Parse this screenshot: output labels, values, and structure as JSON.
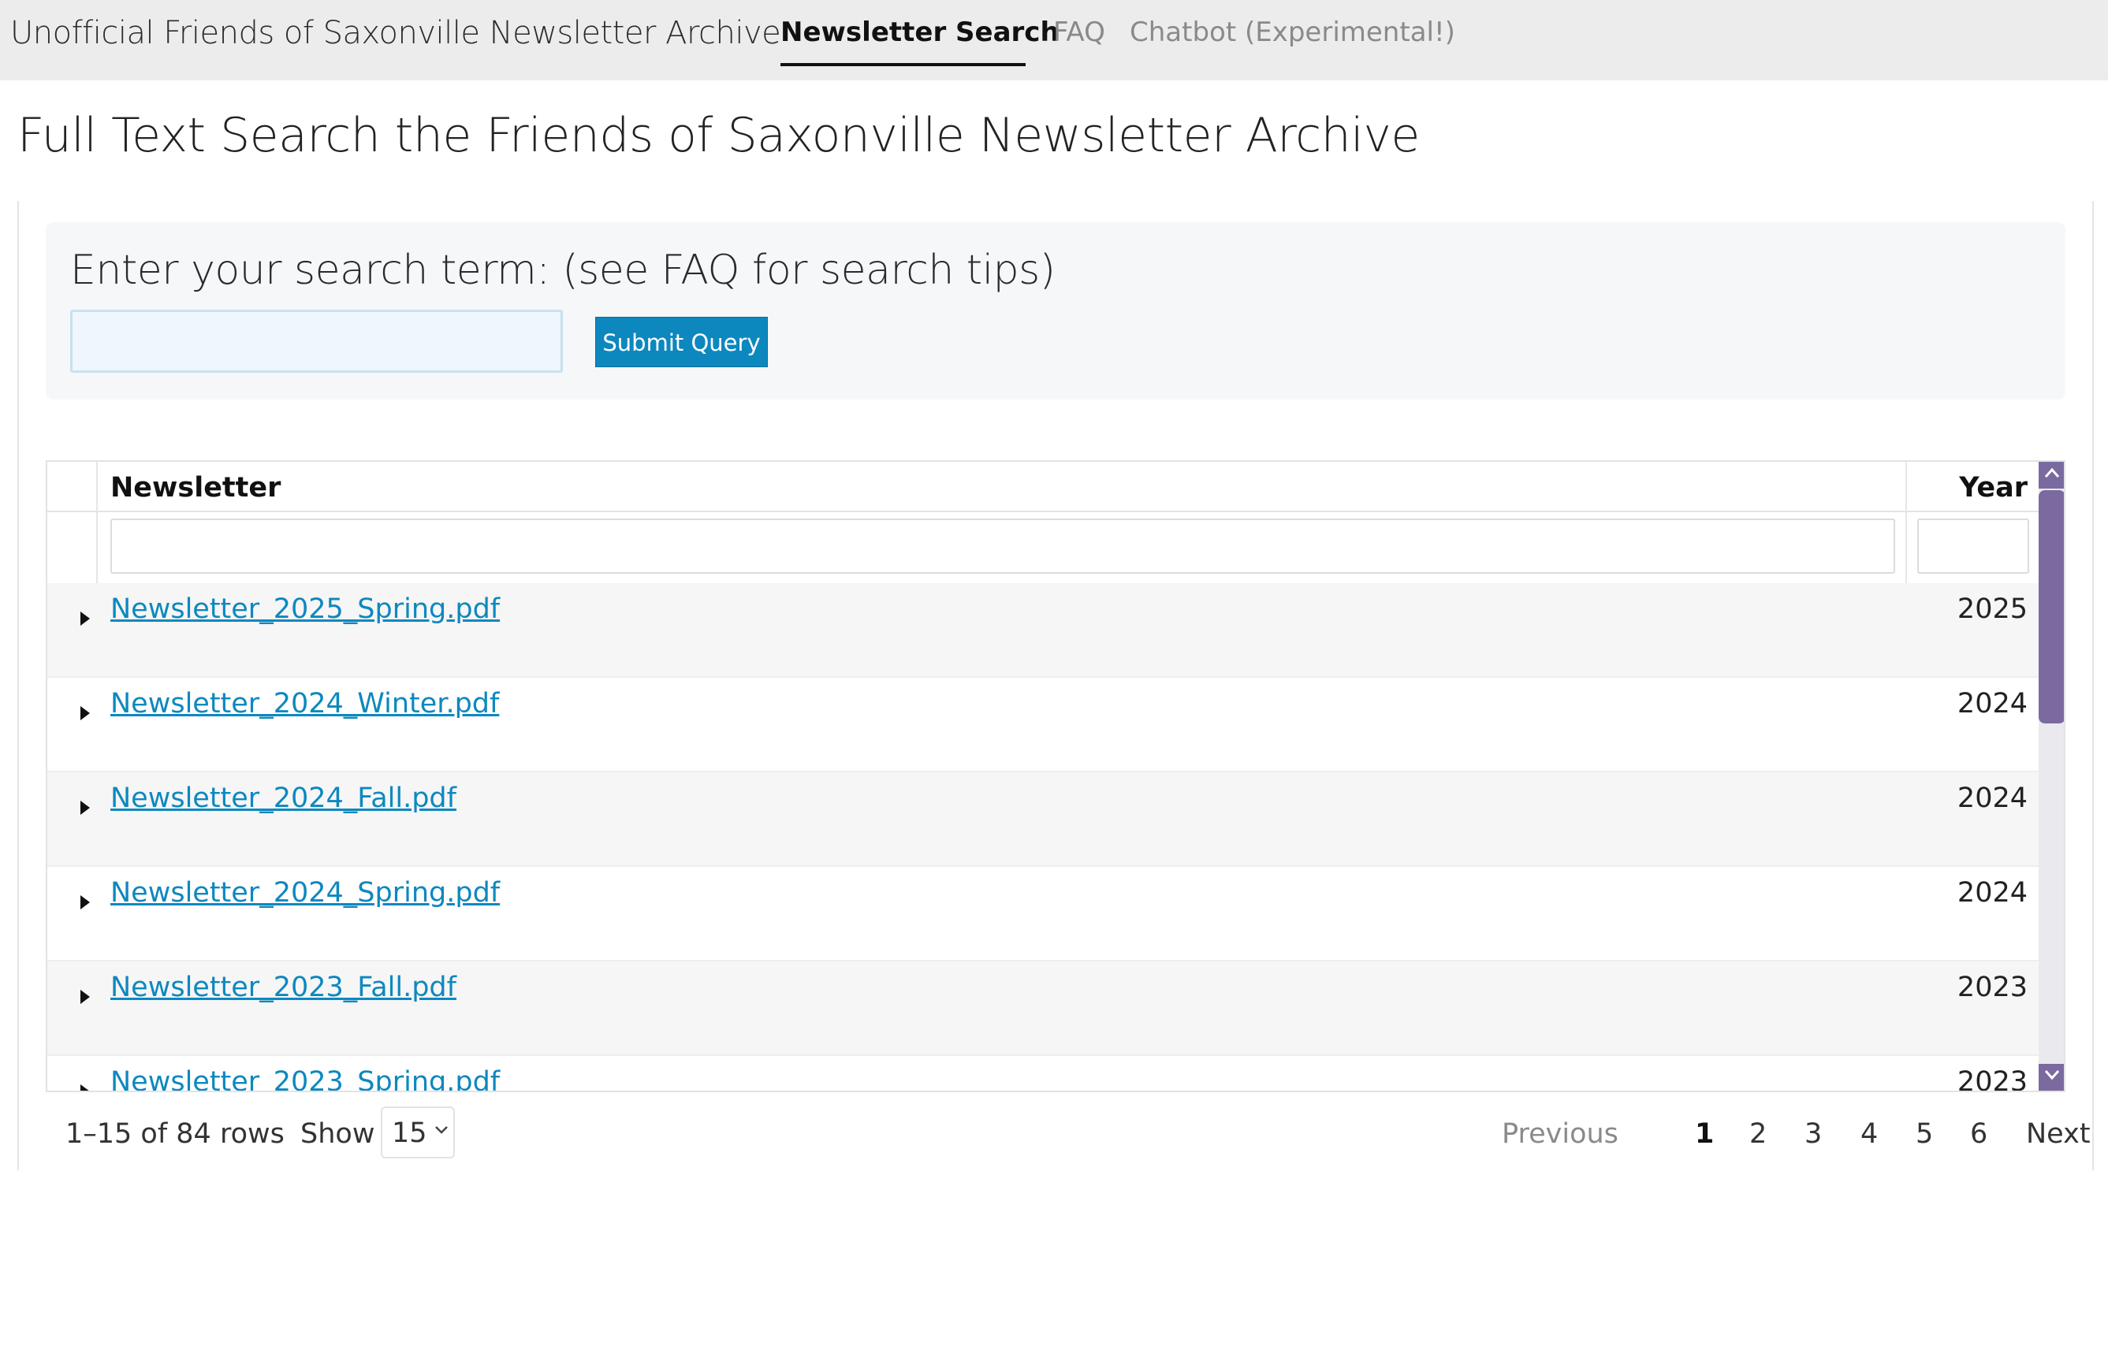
{
  "navbar": {
    "brand": "Unofficial Friends of Saxonville Newsletter Archive",
    "tabs": [
      {
        "label": "Newsletter Search",
        "active": true
      },
      {
        "label": "FAQ",
        "active": false
      },
      {
        "label": "Chatbot (Experimental!)",
        "active": false
      }
    ]
  },
  "page": {
    "title": "Full Text Search the Friends of Saxonville Newsletter Archive"
  },
  "search": {
    "label": "Enter your search term: (see FAQ for search tips)",
    "value": "",
    "placeholder": "",
    "submit_label": "Submit Query"
  },
  "table": {
    "columns": [
      "Newsletter",
      "Year"
    ],
    "filters": {
      "newsletter": "",
      "year": ""
    },
    "rows": [
      {
        "newsletter": "Newsletter_2025_Spring.pdf",
        "year": "2025"
      },
      {
        "newsletter": "Newsletter_2024_Winter.pdf",
        "year": "2024"
      },
      {
        "newsletter": "Newsletter_2024_Fall.pdf",
        "year": "2024"
      },
      {
        "newsletter": "Newsletter_2024_Spring.pdf",
        "year": "2024"
      },
      {
        "newsletter": "Newsletter_2023_Fall.pdf",
        "year": "2023"
      },
      {
        "newsletter": "Newsletter_2023_Spring.pdf",
        "year": "2023"
      }
    ]
  },
  "footer": {
    "rows_info": "1–15 of 84 rows",
    "show_label": "Show",
    "page_size": "15",
    "pager": {
      "previous": "Previous",
      "pages": [
        "1",
        "2",
        "3",
        "4",
        "5",
        "6"
      ],
      "current": "1",
      "next": "Next"
    }
  },
  "colors": {
    "accent": "#0d88bf",
    "scrollbar": "#7a6aa0",
    "navbar_bg": "#ececec"
  },
  "icons": {
    "row_expand": "caret-right-icon",
    "scroll_up": "chevron-up-icon",
    "scroll_down": "chevron-down-icon",
    "select": "chevron-down-icon"
  }
}
